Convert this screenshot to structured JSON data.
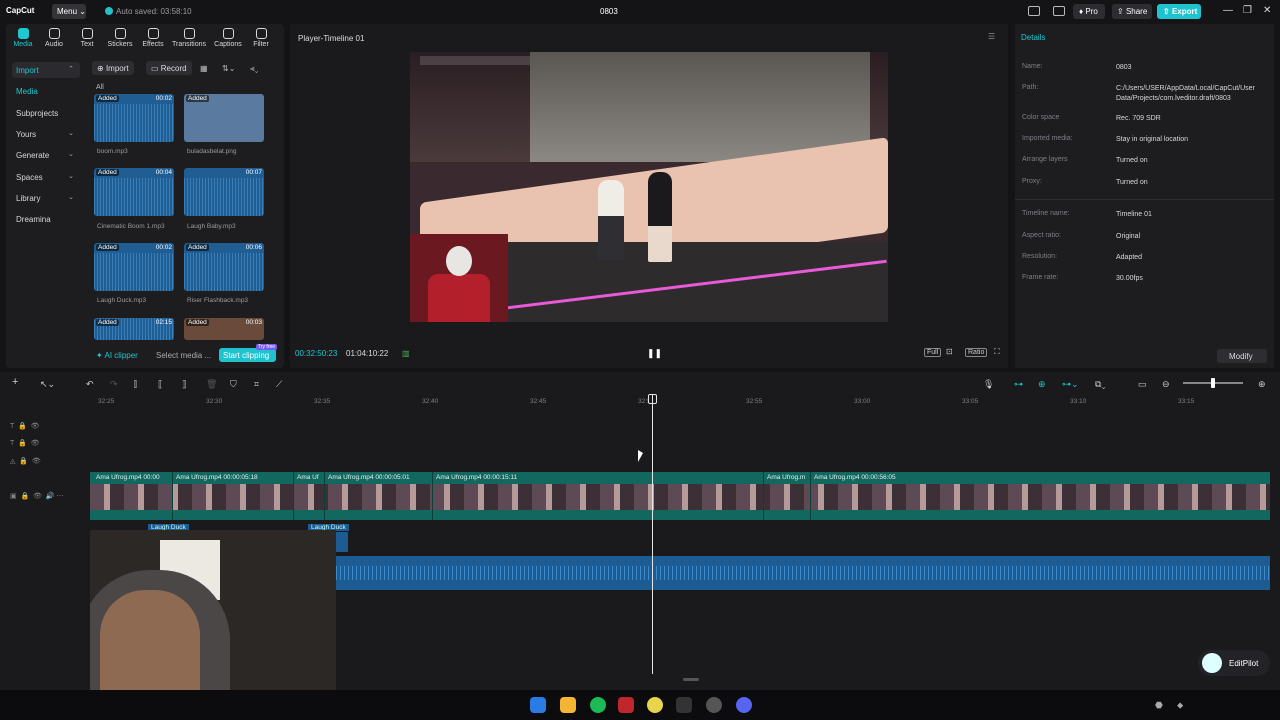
{
  "titlebar": {
    "app_name": "CapCut",
    "menu_label": "Menu",
    "autosave": "Auto saved: 03:58:10",
    "project_title": "0803",
    "pro_label": "Pro",
    "share_label": "Share",
    "export_label": "Export"
  },
  "toolbar_tabs": [
    "Media",
    "Audio",
    "Text",
    "Stickers",
    "Effects",
    "Transitions",
    "Captions",
    "Filter"
  ],
  "sidebar": {
    "import_label": "Import",
    "items": [
      "Media",
      "Subprojects",
      "Yours",
      "Generate",
      "Spaces",
      "Library",
      "Dreamina"
    ]
  },
  "media_toolbar": {
    "import_label": "Import",
    "record_label": "Record",
    "all_label": "All"
  },
  "media_items": [
    {
      "name": "boom.mp3",
      "badge": "Added",
      "duration": "00:02"
    },
    {
      "name": "buladasbelat.png",
      "badge": "Added",
      "duration": ""
    },
    {
      "name": "Cinematic Boom 1.mp3",
      "badge": "Added",
      "duration": "00:04"
    },
    {
      "name": "Laugh Baby.mp3",
      "badge": "",
      "duration": "00:07"
    },
    {
      "name": "Laugh Duck.mp3",
      "badge": "Added",
      "duration": "00:02"
    },
    {
      "name": "Riser Flashback.mp3",
      "badge": "Added",
      "duration": "00:06"
    },
    {
      "name": "",
      "badge": "Added",
      "duration": "02:15"
    },
    {
      "name": "",
      "badge": "Added",
      "duration": "00:03"
    }
  ],
  "ai_bar": {
    "clipper_label": "AI clipper",
    "select_label": "Select media ...",
    "start_label": "Start clipping",
    "try_label": "Try free"
  },
  "player": {
    "title": "Player-Timeline 01",
    "current_time": "00:32:50:23",
    "total_time": "01:04:10:22",
    "full_label": "Full",
    "ratio_label": "Ratio"
  },
  "details": {
    "title": "Details",
    "rows": [
      {
        "k": "Name:",
        "v": "0803"
      },
      {
        "k": "Path:",
        "v": "C:/Users/USER/AppData/Local/CapCut/User Data/Projects/com.lveditor.draft/0803"
      },
      {
        "k": "Color space",
        "v": "Rec. 709 SDR"
      },
      {
        "k": "Imported media:",
        "v": "Stay in original location"
      },
      {
        "k": "Arrange layers",
        "v": "Turned on"
      },
      {
        "k": "Proxy:",
        "v": "Turned on"
      },
      {
        "k": "Timeline name:",
        "v": "Timeline 01"
      },
      {
        "k": "Aspect ratio:",
        "v": "Original"
      },
      {
        "k": "Resolution:",
        "v": "Adapted"
      },
      {
        "k": "Frame rate:",
        "v": "30.00fps"
      }
    ],
    "modify_label": "Modify"
  },
  "timeline": {
    "ruler": [
      "32:25",
      "32:30",
      "32:35",
      "32:40",
      "32:45",
      "32:50",
      "32:55",
      "33:00",
      "33:05",
      "33:10",
      "33:15"
    ],
    "clips": [
      "Ama Ufrog.mp4  00:00",
      "Ama Ufrog.mp4  00:00:05:18",
      "Ama Uf",
      "Ama Ufrog.mp4  00:00:05:01",
      "Ama Ufrog.mp4  00:00:15:11",
      "Ama Ufrog.m",
      "Ama Ufrog.mp4  00:00:56:05"
    ],
    "audio_small_1": "Laugh Duck",
    "audio_small_2": "Laugh Duck"
  },
  "editpilot_label": "EditPilot",
  "colors": {
    "accent": "#1fc8d0",
    "clip": "#12675f",
    "audio": "#1d5b93"
  }
}
